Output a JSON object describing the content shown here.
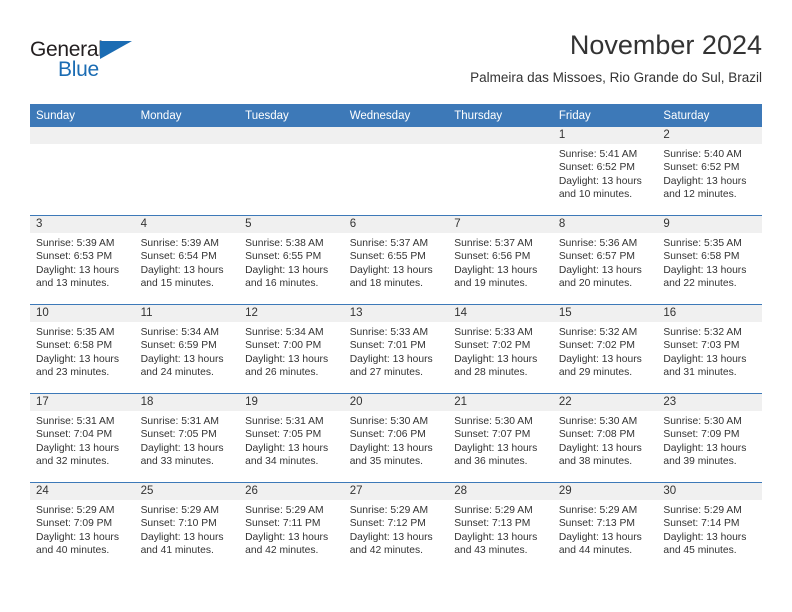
{
  "brand": {
    "word_one": "General",
    "word_two": "Blue",
    "triangle_icon": "triangle-icon",
    "accent_color": "#1b6cb3"
  },
  "header": {
    "title": "November 2024",
    "subtitle": "Palmeira das Missoes, Rio Grande do Sul, Brazil"
  },
  "theme": {
    "header_blue": "#3d79b8",
    "daynum_gray": "#f0f0f0",
    "text": "#333333"
  },
  "calendar": {
    "weekday_headers": [
      "Sunday",
      "Monday",
      "Tuesday",
      "Wednesday",
      "Thursday",
      "Friday",
      "Saturday"
    ],
    "weeks": [
      [
        {
          "day": "",
          "sunrise": "",
          "sunset": "",
          "daylight_a": "",
          "daylight_b": "",
          "empty": true
        },
        {
          "day": "",
          "sunrise": "",
          "sunset": "",
          "daylight_a": "",
          "daylight_b": "",
          "empty": true
        },
        {
          "day": "",
          "sunrise": "",
          "sunset": "",
          "daylight_a": "",
          "daylight_b": "",
          "empty": true
        },
        {
          "day": "",
          "sunrise": "",
          "sunset": "",
          "daylight_a": "",
          "daylight_b": "",
          "empty": true
        },
        {
          "day": "",
          "sunrise": "",
          "sunset": "",
          "daylight_a": "",
          "daylight_b": "",
          "empty": true
        },
        {
          "day": "1",
          "sunrise": "Sunrise: 5:41 AM",
          "sunset": "Sunset: 6:52 PM",
          "daylight_a": "Daylight: 13 hours",
          "daylight_b": "and 10 minutes."
        },
        {
          "day": "2",
          "sunrise": "Sunrise: 5:40 AM",
          "sunset": "Sunset: 6:52 PM",
          "daylight_a": "Daylight: 13 hours",
          "daylight_b": "and 12 minutes."
        }
      ],
      [
        {
          "day": "3",
          "sunrise": "Sunrise: 5:39 AM",
          "sunset": "Sunset: 6:53 PM",
          "daylight_a": "Daylight: 13 hours",
          "daylight_b": "and 13 minutes."
        },
        {
          "day": "4",
          "sunrise": "Sunrise: 5:39 AM",
          "sunset": "Sunset: 6:54 PM",
          "daylight_a": "Daylight: 13 hours",
          "daylight_b": "and 15 minutes."
        },
        {
          "day": "5",
          "sunrise": "Sunrise: 5:38 AM",
          "sunset": "Sunset: 6:55 PM",
          "daylight_a": "Daylight: 13 hours",
          "daylight_b": "and 16 minutes."
        },
        {
          "day": "6",
          "sunrise": "Sunrise: 5:37 AM",
          "sunset": "Sunset: 6:55 PM",
          "daylight_a": "Daylight: 13 hours",
          "daylight_b": "and 18 minutes."
        },
        {
          "day": "7",
          "sunrise": "Sunrise: 5:37 AM",
          "sunset": "Sunset: 6:56 PM",
          "daylight_a": "Daylight: 13 hours",
          "daylight_b": "and 19 minutes."
        },
        {
          "day": "8",
          "sunrise": "Sunrise: 5:36 AM",
          "sunset": "Sunset: 6:57 PM",
          "daylight_a": "Daylight: 13 hours",
          "daylight_b": "and 20 minutes."
        },
        {
          "day": "9",
          "sunrise": "Sunrise: 5:35 AM",
          "sunset": "Sunset: 6:58 PM",
          "daylight_a": "Daylight: 13 hours",
          "daylight_b": "and 22 minutes."
        }
      ],
      [
        {
          "day": "10",
          "sunrise": "Sunrise: 5:35 AM",
          "sunset": "Sunset: 6:58 PM",
          "daylight_a": "Daylight: 13 hours",
          "daylight_b": "and 23 minutes."
        },
        {
          "day": "11",
          "sunrise": "Sunrise: 5:34 AM",
          "sunset": "Sunset: 6:59 PM",
          "daylight_a": "Daylight: 13 hours",
          "daylight_b": "and 24 minutes."
        },
        {
          "day": "12",
          "sunrise": "Sunrise: 5:34 AM",
          "sunset": "Sunset: 7:00 PM",
          "daylight_a": "Daylight: 13 hours",
          "daylight_b": "and 26 minutes."
        },
        {
          "day": "13",
          "sunrise": "Sunrise: 5:33 AM",
          "sunset": "Sunset: 7:01 PM",
          "daylight_a": "Daylight: 13 hours",
          "daylight_b": "and 27 minutes."
        },
        {
          "day": "14",
          "sunrise": "Sunrise: 5:33 AM",
          "sunset": "Sunset: 7:02 PM",
          "daylight_a": "Daylight: 13 hours",
          "daylight_b": "and 28 minutes."
        },
        {
          "day": "15",
          "sunrise": "Sunrise: 5:32 AM",
          "sunset": "Sunset: 7:02 PM",
          "daylight_a": "Daylight: 13 hours",
          "daylight_b": "and 29 minutes."
        },
        {
          "day": "16",
          "sunrise": "Sunrise: 5:32 AM",
          "sunset": "Sunset: 7:03 PM",
          "daylight_a": "Daylight: 13 hours",
          "daylight_b": "and 31 minutes."
        }
      ],
      [
        {
          "day": "17",
          "sunrise": "Sunrise: 5:31 AM",
          "sunset": "Sunset: 7:04 PM",
          "daylight_a": "Daylight: 13 hours",
          "daylight_b": "and 32 minutes."
        },
        {
          "day": "18",
          "sunrise": "Sunrise: 5:31 AM",
          "sunset": "Sunset: 7:05 PM",
          "daylight_a": "Daylight: 13 hours",
          "daylight_b": "and 33 minutes."
        },
        {
          "day": "19",
          "sunrise": "Sunrise: 5:31 AM",
          "sunset": "Sunset: 7:05 PM",
          "daylight_a": "Daylight: 13 hours",
          "daylight_b": "and 34 minutes."
        },
        {
          "day": "20",
          "sunrise": "Sunrise: 5:30 AM",
          "sunset": "Sunset: 7:06 PM",
          "daylight_a": "Daylight: 13 hours",
          "daylight_b": "and 35 minutes."
        },
        {
          "day": "21",
          "sunrise": "Sunrise: 5:30 AM",
          "sunset": "Sunset: 7:07 PM",
          "daylight_a": "Daylight: 13 hours",
          "daylight_b": "and 36 minutes."
        },
        {
          "day": "22",
          "sunrise": "Sunrise: 5:30 AM",
          "sunset": "Sunset: 7:08 PM",
          "daylight_a": "Daylight: 13 hours",
          "daylight_b": "and 38 minutes."
        },
        {
          "day": "23",
          "sunrise": "Sunrise: 5:30 AM",
          "sunset": "Sunset: 7:09 PM",
          "daylight_a": "Daylight: 13 hours",
          "daylight_b": "and 39 minutes."
        }
      ],
      [
        {
          "day": "24",
          "sunrise": "Sunrise: 5:29 AM",
          "sunset": "Sunset: 7:09 PM",
          "daylight_a": "Daylight: 13 hours",
          "daylight_b": "and 40 minutes."
        },
        {
          "day": "25",
          "sunrise": "Sunrise: 5:29 AM",
          "sunset": "Sunset: 7:10 PM",
          "daylight_a": "Daylight: 13 hours",
          "daylight_b": "and 41 minutes."
        },
        {
          "day": "26",
          "sunrise": "Sunrise: 5:29 AM",
          "sunset": "Sunset: 7:11 PM",
          "daylight_a": "Daylight: 13 hours",
          "daylight_b": "and 42 minutes."
        },
        {
          "day": "27",
          "sunrise": "Sunrise: 5:29 AM",
          "sunset": "Sunset: 7:12 PM",
          "daylight_a": "Daylight: 13 hours",
          "daylight_b": "and 42 minutes."
        },
        {
          "day": "28",
          "sunrise": "Sunrise: 5:29 AM",
          "sunset": "Sunset: 7:13 PM",
          "daylight_a": "Daylight: 13 hours",
          "daylight_b": "and 43 minutes."
        },
        {
          "day": "29",
          "sunrise": "Sunrise: 5:29 AM",
          "sunset": "Sunset: 7:13 PM",
          "daylight_a": "Daylight: 13 hours",
          "daylight_b": "and 44 minutes."
        },
        {
          "day": "30",
          "sunrise": "Sunrise: 5:29 AM",
          "sunset": "Sunset: 7:14 PM",
          "daylight_a": "Daylight: 13 hours",
          "daylight_b": "and 45 minutes."
        }
      ]
    ]
  }
}
